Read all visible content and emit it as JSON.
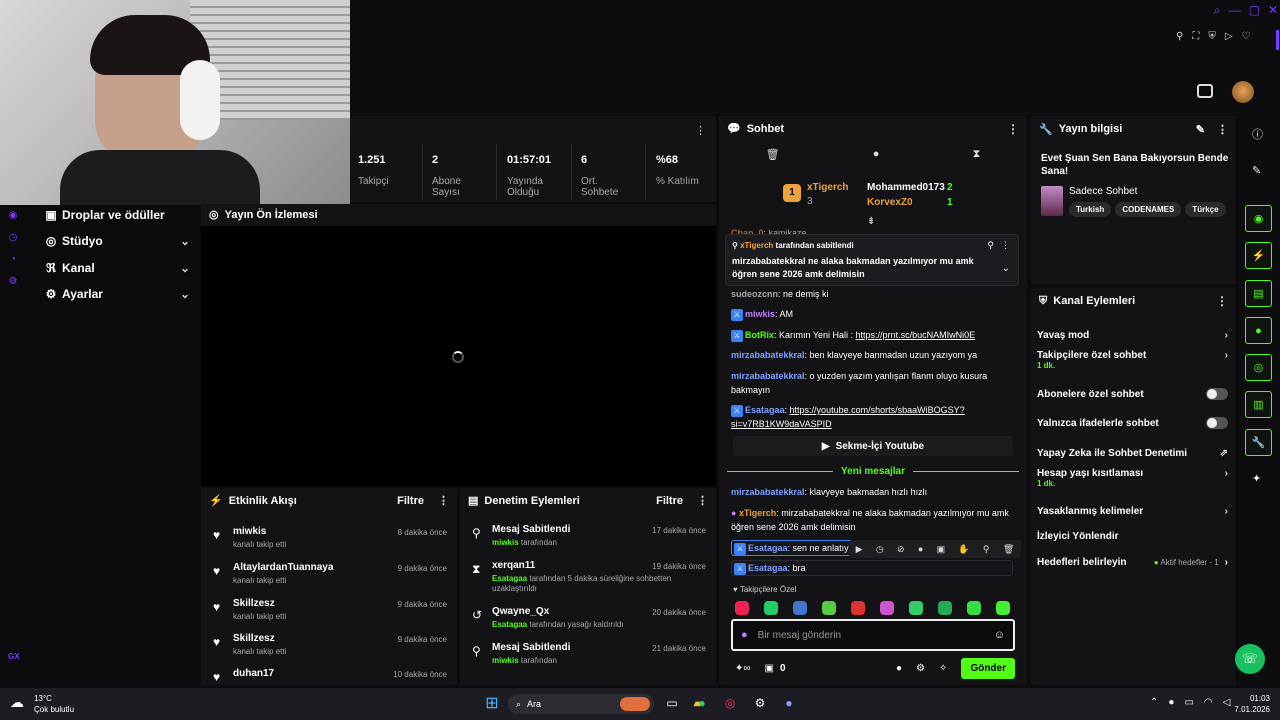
{
  "colors": {
    "accent": "#53fc18",
    "bg": "#0b0b0e",
    "panel": "#131316",
    "purple": "#7a3cff"
  },
  "stats": [
    {
      "value": "1.251",
      "label": "Takipçi"
    },
    {
      "value": "2",
      "label": "Abone Sayısı"
    },
    {
      "value": "01:57:01",
      "label": "Yayında Olduğu"
    },
    {
      "value": "6",
      "label": "Ort. Sohbete"
    },
    {
      "value": "%68",
      "label": "% Katılım"
    }
  ],
  "sidebar": {
    "items": [
      {
        "label": "Droplar ve ödüller",
        "icon": "gift-icon"
      },
      {
        "label": "Stüdyo",
        "icon": "studio-icon"
      },
      {
        "label": "Kanal",
        "icon": "channel-icon"
      },
      {
        "label": "Ayarlar",
        "icon": "gear-icon"
      }
    ],
    "gx": "GX"
  },
  "preview": {
    "title": "Yayın Ön İzlemesi"
  },
  "activity": {
    "title": "Etkinlik Akışı",
    "filter": "Filtre",
    "items": [
      {
        "name": "miwkis",
        "sub": "kanalı takip etti",
        "time": "8 dakika önce"
      },
      {
        "name": "AltaylardanTuannaya",
        "sub": "kanalı takip etti",
        "time": "9 dakika önce"
      },
      {
        "name": "Skillzesz",
        "sub": "kanalı takip etti",
        "time": "9 dakika önce"
      },
      {
        "name": "Skillzesz",
        "sub": "kanalı takip etti",
        "time": "9 dakika önce"
      },
      {
        "name": "duhan17",
        "sub": "",
        "time": "10 dakika önce"
      }
    ]
  },
  "moderation": {
    "title": "Denetim Eylemleri",
    "filter": "Filtre",
    "items": [
      {
        "name": "Mesaj Sabitlendi",
        "actor": "miwkis",
        "sub": "tarafından",
        "time": "17 dakika önce",
        "icon": "pin-icon"
      },
      {
        "name": "xerqan11",
        "actor": "Esatagaa",
        "sub": "tarafından 5 dakika süreliğine sohbetten uzaklaştırıldı",
        "time": "19 dakika önce",
        "icon": "hourglass-icon"
      },
      {
        "name": "Qwayne_Qx",
        "actor": "Esatagaa",
        "sub": "tarafından yasağı kaldırıldı",
        "time": "20 dakika önce",
        "icon": "undo-icon"
      },
      {
        "name": "Mesaj Sabitlendi",
        "actor": "miwkis",
        "sub": "tarafından",
        "time": "21 dakika önce",
        "icon": "pin-icon"
      }
    ]
  },
  "chat": {
    "title": "Sohbet",
    "leaders": {
      "rank": "1",
      "first": "xTigerch",
      "first_count": "3",
      "second": "Mohammed0173",
      "second_count": "2",
      "third": "KorvexZ0",
      "third_count": "1"
    },
    "pinned": {
      "by": "xTigerch",
      "by_suffix": "tarafından sabitlendi",
      "text": "mirzababatekkral ne alaka bakmadan yazılmıyor mu amk öğren sene 2026 amk delimisin"
    },
    "cut_msg": {
      "user": "Chan_0",
      "text": ": kamikaze"
    },
    "messages": [
      {
        "user": "sudeozcnn",
        "text": ": ne demiş ki"
      },
      {
        "user": "miwkis",
        "text": ": AM"
      },
      {
        "user": "BotRix",
        "text": ": Karımın Yeni Hali : ",
        "link": "https://prnt.sc/bucNAMIwNi0E"
      },
      {
        "user": "mirzababatekkral",
        "text": ": ben klavyeye banmadan uzun yazıyom ya"
      },
      {
        "user": "mirzababatekkral",
        "text": ": o yuzden yazım yanlışarı flanm oluyo kusura bakmayın"
      },
      {
        "user": "Esatagaa",
        "text": ": ",
        "link": "https://youtube.com/shorts/sbaaWiBOGSY?si=v7RB1KW9daVASPID"
      }
    ],
    "youtube_btn": "Sekme-İçi Youtube",
    "new_messages": "Yeni mesajlar",
    "messages2": [
      {
        "user": "mirzababatekkral",
        "text": ": klavyeye bakmadan hızlı hızlı"
      },
      {
        "user": "xTigerch",
        "text": ": mirzababatekkral ne alaka bakmadan yazılmıyor mu amk öğren sene 2026 amk delimisin"
      },
      {
        "user": "Esatagaa",
        "text": ": sen ne anlatıy"
      },
      {
        "user": "Esatagaa",
        "text": ": bra"
      }
    ],
    "emote_label": "Takipçilere Özel",
    "input_placeholder": "Bir mesaj gönderin",
    "points": "0",
    "send": "Gönder"
  },
  "stream_info": {
    "title": "Yayın bilgisi",
    "stream_title": "Evet Şuan Sen Bana Bakıyorsun Bende Sana!",
    "category": "Sadece Sohbet",
    "tags": [
      "Turkish",
      "CODENAMES",
      "Türkçe"
    ]
  },
  "channel_actions": {
    "title": "Kanal Eylemleri",
    "items": [
      {
        "label": "Yavaş mod",
        "sub": "",
        "control": "chevron"
      },
      {
        "label": "Takipçilere özel sohbet",
        "sub": "1 dk.",
        "control": "chevron"
      },
      {
        "label": "Abonelere özel sohbet",
        "sub": "",
        "control": "toggle"
      },
      {
        "label": "Yalnızca ifadelerle sohbet",
        "sub": "",
        "control": "toggle"
      },
      {
        "label": "Yapay Zeka ile Sohbet Denetimi",
        "sub": "",
        "control": "external"
      },
      {
        "label": "Hesap yaşı kısıtlaması",
        "sub": "1 dk.",
        "control": "chevron"
      },
      {
        "label": "Yasaklanmış kelimeler",
        "sub": "",
        "control": "chevron"
      },
      {
        "label": "İzleyici Yönlendir",
        "sub": "",
        "control": "none"
      },
      {
        "label": "Hedefleri belirleyin",
        "sub": "",
        "control": "chevron",
        "extra": "Aktif hedefler - 1"
      }
    ]
  },
  "taskbar": {
    "temp": "13°C",
    "weather": "Çok bulutlu",
    "search": "Ara",
    "time": "01:03",
    "date": "7.01.2026"
  }
}
